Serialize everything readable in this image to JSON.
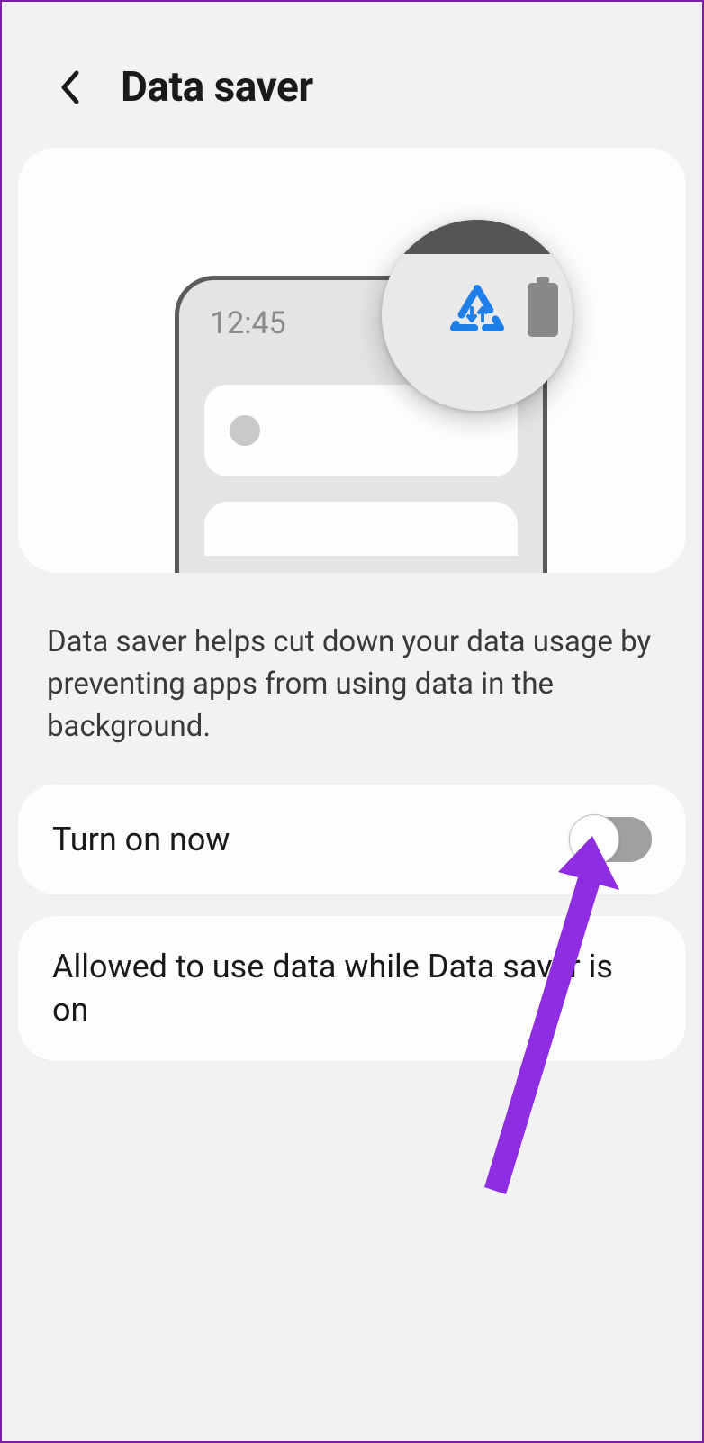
{
  "header": {
    "title": "Data saver"
  },
  "illustration": {
    "time": "12:45"
  },
  "description": "Data saver helps cut down your data usage by preventing apps from using data in the background.",
  "toggle_row": {
    "label": "Turn on now",
    "state": false
  },
  "allowed_row": {
    "label": "Allowed to use data while Data saver is on"
  }
}
